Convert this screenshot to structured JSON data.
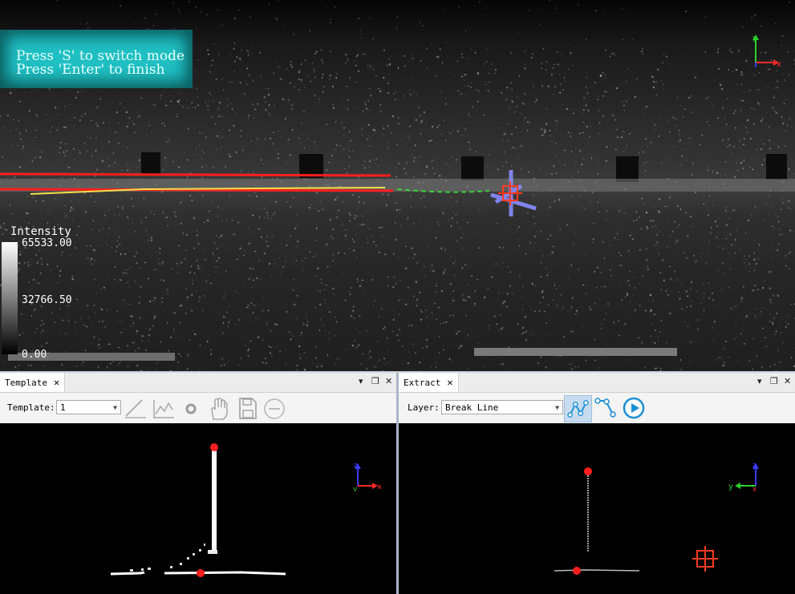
{
  "viewport": {
    "hint_lines": [
      "Press 'S' to switch mode",
      "Press 'Enter' to finish"
    ],
    "legend": {
      "title": "Intensity",
      "max": "65533.00",
      "mid": "32766.50",
      "min": "0.00"
    },
    "axis_labels": {
      "x": "x",
      "y": "y"
    }
  },
  "template_panel": {
    "tab_label": "Template",
    "close_glyph": "✕",
    "menu_glyph": "▾",
    "float_glyph": "❐",
    "template_label": "Template:",
    "template_value": "1",
    "tools": [
      "pencil-icon",
      "line-chart-icon",
      "point-icon",
      "hand-icon",
      "save-icon",
      "minus-circle-icon"
    ],
    "axis_labels": {
      "x": "x",
      "y": "y",
      "z": "z"
    }
  },
  "extract_panel": {
    "tab_label": "Extract",
    "close_glyph": "✕",
    "menu_glyph": "▾",
    "float_glyph": "❐",
    "layer_label": "Layer:",
    "layer_value": "Break Line",
    "tools": [
      "break-line-icon",
      "polyline-icon",
      "play-icon"
    ],
    "axis_labels": {
      "x": "x",
      "y": "y",
      "z": "z"
    }
  },
  "colors": {
    "red_line": "#ff1e1e",
    "yellow_line": "#f5e04a",
    "green_line": "#39d13a",
    "hint_bg": "#1fbfc2",
    "tool_active": "#c7dcef",
    "play_blue": "#1a8fd8"
  }
}
